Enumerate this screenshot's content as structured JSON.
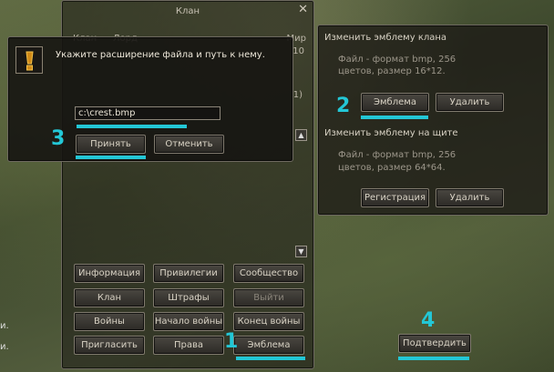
{
  "clan_window": {
    "title": "Клан",
    "partial_labels": [
      "Клан",
      "Лорд",
      "Мир"
    ],
    "partial_value": "1)",
    "partial_number": "10",
    "buttons": [
      [
        "Информация",
        "Привилегии",
        "Сообщество"
      ],
      [
        "Клан",
        "Штрафы",
        "Выйти"
      ],
      [
        "Войны",
        "Начало войны",
        "Конец войны"
      ],
      [
        "Пригласить",
        "Права",
        "Эмблема"
      ]
    ]
  },
  "file_dialog": {
    "prompt": "Укажите расширение файла и путь к нему.",
    "path_value": "c:\\crest.bmp",
    "accept_label": "Принять",
    "cancel_label": "Отменить"
  },
  "emblem_panel": {
    "clan_title": "Изменить эмблему клана",
    "clan_desc_1": "Файл - формат bmp, 256",
    "clan_desc_2": "цветов, размер 16*12.",
    "clan_emblem_label": "Эмблема",
    "clan_delete_label": "Удалить",
    "shield_title": "Изменить эмблему на щите",
    "shield_desc_1": "Файл - формат bmp, 256",
    "shield_desc_2": "цветов, размер 64*64.",
    "shield_register_label": "Регистрация",
    "shield_delete_label": "Удалить",
    "confirm_label": "Подтвердить"
  },
  "left_partial": [
    "и.",
    "и."
  ],
  "steps": [
    "1",
    "2",
    "3",
    "4"
  ],
  "highlight_color": "#23c7d6"
}
